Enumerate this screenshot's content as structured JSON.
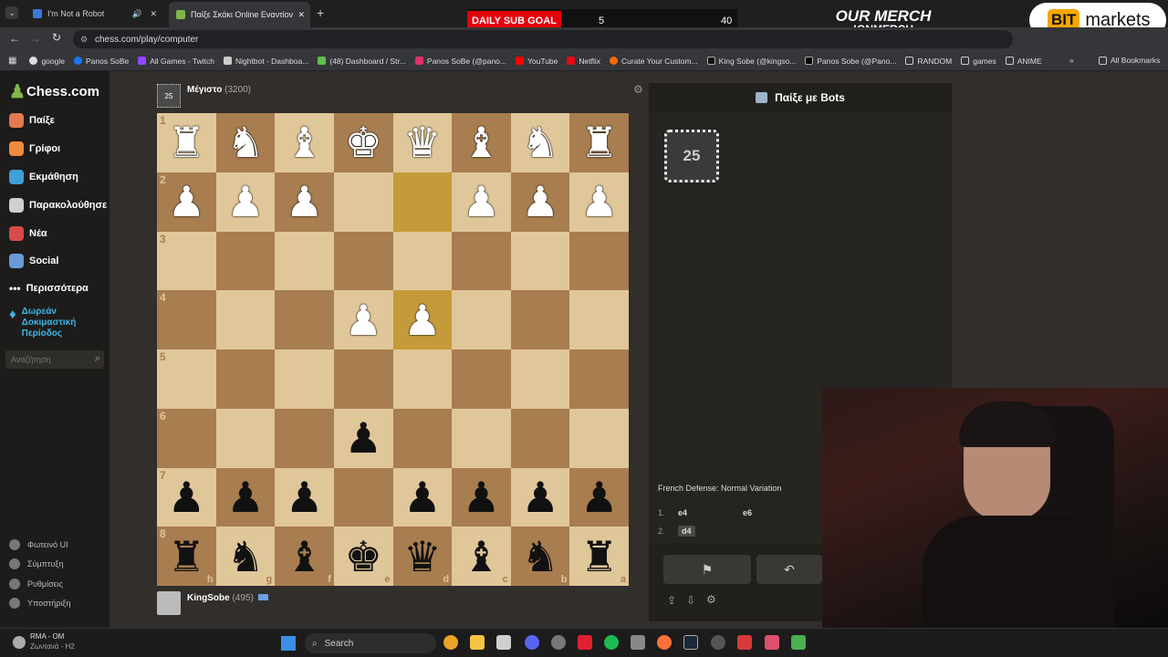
{
  "tabs": [
    {
      "label": "I'm Not a Robot",
      "active": false
    },
    {
      "label": "Παίξε Σκάκι Online Εναντίον το...",
      "active": true
    }
  ],
  "address": "chess.com/play/computer",
  "bookmarks": [
    "google",
    "Panos SoBe",
    "All Games - Twitch",
    "Nightbot - Dashboa...",
    "(48) Dashboard / Str...",
    "Panos SoBe (@pano...",
    "YouTube",
    "Netflix",
    "Curate Your Custom...",
    "King Sobe (@kingso...",
    "Panos Sobe (@Pano...",
    "RANDOM",
    "games",
    "ANIME"
  ],
  "bookmarks_all": "All Bookmarks",
  "subgoal": {
    "label": "DAILY SUB GOAL",
    "current": "5",
    "target": "40"
  },
  "merch": {
    "line1": "OUR MERCH",
    "line2": "!GNMERCH"
  },
  "ad": {
    "bit": "BIT",
    "text": "markets"
  },
  "sidebar": {
    "logo": "Chess.com",
    "items": [
      "Παίξε",
      "Γρίφοι",
      "Εκμάθηση",
      "Παρακολούθησε",
      "Νέα",
      "Social",
      "Περισσότερα"
    ],
    "trial": "Δωρεάν Δοκιμαστική Περίοδος",
    "search_placeholder": "Αναζήτηση",
    "footer": [
      "Φωτεινό UI",
      "Σύμπτυξη",
      "Ρυθμίσεις",
      "Υποστήριξη"
    ]
  },
  "opponent": {
    "name": "Μέγιστο",
    "rating": "(3200)",
    "badge": "25"
  },
  "player": {
    "name": "KingSobe",
    "rating": "(495)"
  },
  "board": {
    "ranks": [
      "1",
      "2",
      "3",
      "4",
      "5",
      "6",
      "7",
      "8"
    ],
    "files_bottom": [
      "h",
      "g",
      "f",
      "e",
      "d",
      "c",
      "b",
      "a"
    ],
    "rows": [
      [
        "♜",
        "♞",
        "♝",
        "♚",
        "♛",
        "♝",
        "♞",
        "♜"
      ],
      [
        "♟",
        "♟",
        "♟",
        "",
        "",
        "♟",
        "♟",
        "♟"
      ],
      [
        "",
        "",
        "",
        "",
        "",
        "",
        "",
        ""
      ],
      [
        "",
        "",
        "",
        "♟",
        "♟",
        "",
        "",
        ""
      ],
      [
        "",
        "",
        "",
        "",
        "",
        "",
        "",
        ""
      ],
      [
        "",
        "",
        "",
        "♟",
        "",
        "",
        "",
        ""
      ],
      [
        "♟",
        "♟",
        "♟",
        "",
        "♟",
        "♟",
        "♟",
        "♟"
      ],
      [
        "♜",
        "♞",
        "♝",
        "♚",
        "♛",
        "♝",
        "♞",
        "♜"
      ]
    ],
    "colors": [
      [
        "w",
        "w",
        "w",
        "w",
        "w",
        "w",
        "w",
        "w"
      ],
      [
        "w",
        "w",
        "w",
        "",
        "",
        "w",
        "w",
        "w"
      ],
      [
        "",
        "",
        "",
        "",
        "",
        "",
        "",
        ""
      ],
      [
        "",
        "",
        "",
        "w",
        "w",
        "",
        "",
        ""
      ],
      [
        "",
        "",
        "",
        "",
        "",
        "",
        "",
        ""
      ],
      [
        "",
        "",
        "",
        "b",
        "",
        "",
        "",
        ""
      ],
      [
        "b",
        "b",
        "b",
        "",
        "b",
        "b",
        "b",
        "b"
      ],
      [
        "b",
        "b",
        "b",
        "b",
        "b",
        "b",
        "b",
        "b"
      ]
    ]
  },
  "panel": {
    "title": "Παίξε με Bots",
    "bot_level": "25",
    "opening": "French Defense: Normal Variation",
    "moves": [
      {
        "num": "1.",
        "white": "e4",
        "black": "e6"
      },
      {
        "num": "2.",
        "white": "d4",
        "black": ""
      }
    ]
  },
  "taskbar": {
    "search": "Search",
    "app_title": "RMA - OM",
    "app_subtitle": "Ζωντανά - H2"
  }
}
